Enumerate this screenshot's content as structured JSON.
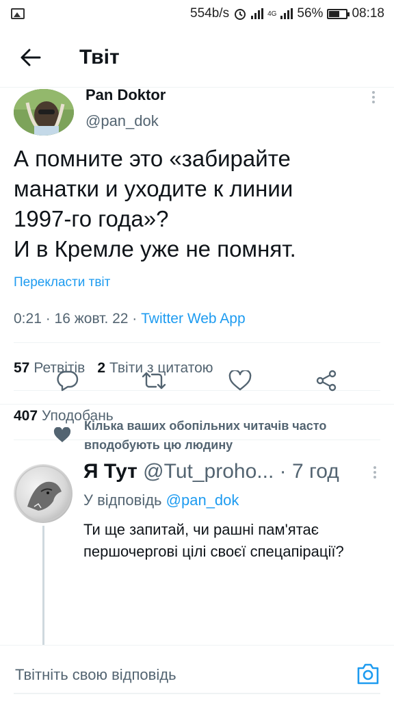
{
  "status_bar": {
    "network_speed": "554b/s",
    "network_type": "4G",
    "battery": "56%",
    "time": "08:18"
  },
  "header": {
    "title": "Твіт"
  },
  "tweet": {
    "author_name": "Pan Doktor",
    "author_handle": "@pan_dok",
    "text": "А помните это «забирайте\nманатки и уходите к линии\n1997-го года»?\nИ в Кремле уже не помнят.",
    "translate_label": "Перекласти твіт",
    "meta_time": "0:21 · 16 жовт. 22 · ",
    "meta_app": "Twitter Web App",
    "retweets_count": "57",
    "retweets_label": "Ретвітів",
    "quotes_count": "2",
    "quotes_label": "Твіти з цитатою",
    "likes_count": "407",
    "likes_label": "Уподобань"
  },
  "social_context": {
    "text": "Кілька ваших обопільних читачів часто вподобують цю людину"
  },
  "reply": {
    "author_name": "Я Тут",
    "author_handle": "@Tut_proho...",
    "time": "· 7 год",
    "reply_to_prefix": "У відповідь",
    "reply_to_handle": "@pan_dok",
    "text": "Ти ще запитай, чи рашні пам'ятає\nпершочергові цілі своєї спецапірації?"
  },
  "compose": {
    "placeholder": "Твітніть свою відповідь"
  },
  "colors": {
    "accent": "#1d9bf0",
    "secondary_text": "#536471",
    "divider": "#eff3f4"
  },
  "icons": [
    "image-icon",
    "alarm-icon",
    "signal-icon",
    "battery-icon",
    "back-arrow-icon",
    "more-vertical-icon",
    "reply-icon",
    "retweet-icon",
    "like-icon",
    "share-icon",
    "heart-icon",
    "camera-icon"
  ]
}
